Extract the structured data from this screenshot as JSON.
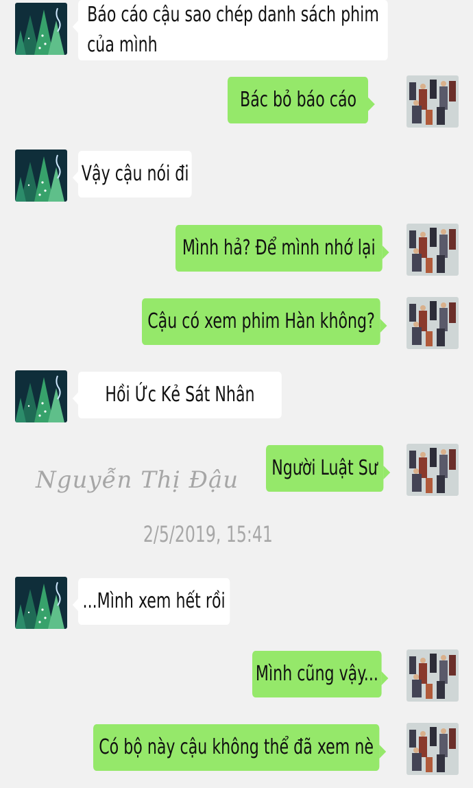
{
  "colors": {
    "background": "#f1f1f1",
    "sent_bubble": "#95e86a",
    "received_bubble": "#ffffff",
    "timestamp": "#a7a7a7"
  },
  "messages": [
    {
      "side": "left",
      "text": "Báo cáo cậu sao chép danh sách phim\ncủa mình"
    },
    {
      "side": "right",
      "text": "Bác bỏ báo cáo"
    },
    {
      "side": "left",
      "text": "Vậy cậu nói đi"
    },
    {
      "side": "right",
      "text": "Mình hả? Để mình nhớ lại"
    },
    {
      "side": "right",
      "text": "Cậu có xem phim Hàn không?"
    },
    {
      "side": "left",
      "text": "Hồi Ức Kẻ Sát Nhân"
    },
    {
      "side": "right",
      "text": "Người Luật Sư"
    },
    {
      "side": "left",
      "text": "...Mình xem hết rồi"
    },
    {
      "side": "right",
      "text": "Mình cũng vậy..."
    },
    {
      "side": "right",
      "text": "Có bộ này cậu không thể đã xem nè"
    }
  ],
  "timestamp": "2/5/2019, 15:41",
  "watermark": "Nguyễn Thị Đậu",
  "avatars": {
    "left": "forest-avatar-icon",
    "right": "crowd-avatar-icon"
  }
}
